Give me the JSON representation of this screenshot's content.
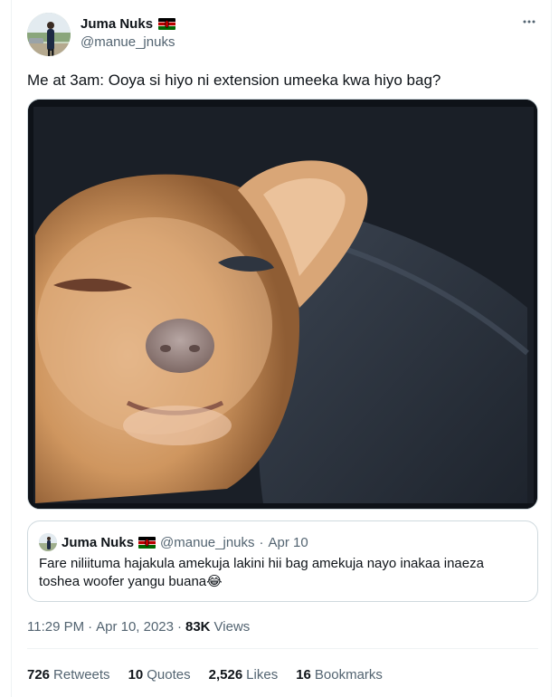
{
  "author": {
    "name": "Juma Nuks",
    "handle": "@manue_jnuks"
  },
  "tweet": {
    "text": "Me at 3am: Ooya si hiyo ni extension umeeka kwa hiyo bag?"
  },
  "quote": {
    "name": "Juma Nuks",
    "handle": "@manue_jnuks",
    "separator": "·",
    "date": "Apr 10",
    "text": "Fare niliituma hajakula amekuja lakini hii bag amekuja nayo inakaa inaeza toshea woofer yangu buana😂"
  },
  "meta": {
    "time": "11:29 PM",
    "separator1": "·",
    "date": "Apr 10, 2023",
    "separator2": "·",
    "views_count": "83K",
    "views_label": "Views"
  },
  "stats": {
    "retweets_count": "726",
    "retweets_label": "Retweets",
    "quotes_count": "10",
    "quotes_label": "Quotes",
    "likes_count": "2,526",
    "likes_label": "Likes",
    "bookmarks_count": "16",
    "bookmarks_label": "Bookmarks"
  },
  "icons": {
    "more": "more-horizontal-icon",
    "flag": "kenya-flag-icon"
  },
  "colors": {
    "secondary_text": "#536471",
    "primary_text": "#0f1419",
    "border": "#cfd9de"
  }
}
